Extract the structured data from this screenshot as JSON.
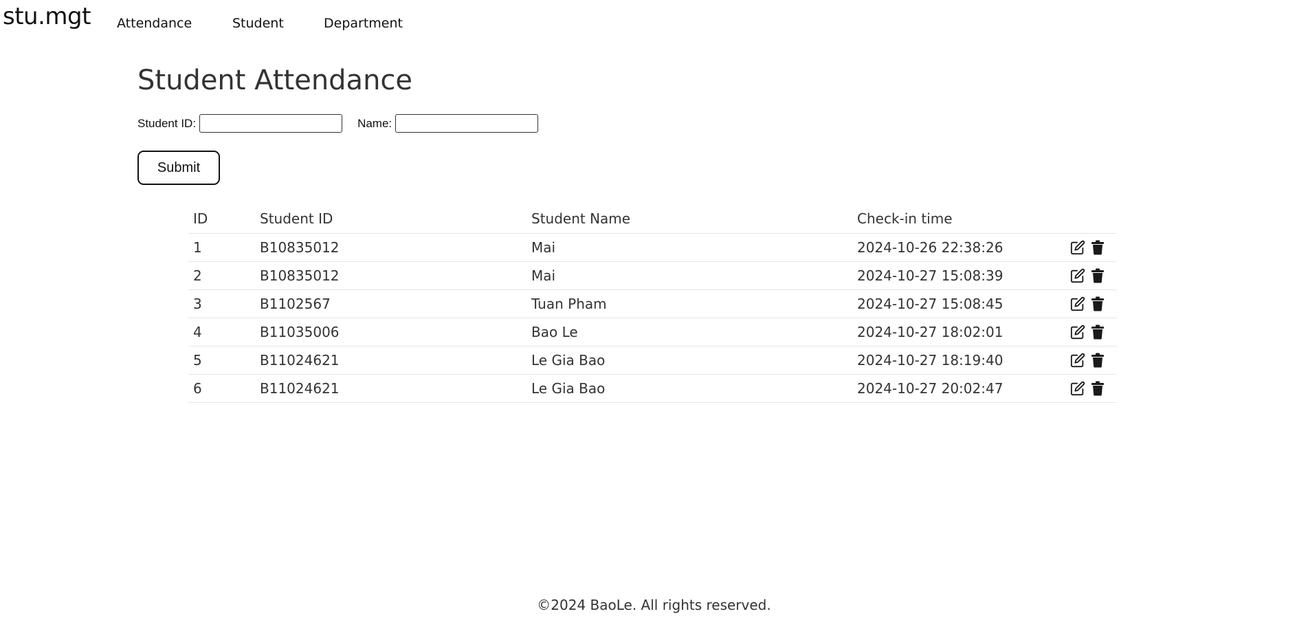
{
  "nav": {
    "brand": "stu.mgt",
    "links": [
      "Attendance",
      "Student",
      "Department"
    ]
  },
  "main": {
    "title": "Student Attendance",
    "form": {
      "student_id_label": "Student ID:",
      "student_id_value": "",
      "name_label": "Name:",
      "name_value": "",
      "submit_label": "Submit"
    },
    "table": {
      "headers": [
        "ID",
        "Student ID",
        "Student Name",
        "Check-in time",
        ""
      ],
      "rows": [
        {
          "id": "1",
          "student_id": "B10835012",
          "name": "Mai",
          "time": "2024-10-26 22:38:26"
        },
        {
          "id": "2",
          "student_id": "B10835012",
          "name": "Mai",
          "time": "2024-10-27 15:08:39"
        },
        {
          "id": "3",
          "student_id": "B1102567",
          "name": "Tuan Pham",
          "time": "2024-10-27 15:08:45"
        },
        {
          "id": "4",
          "student_id": "B11035006",
          "name": "Bao Le",
          "time": "2024-10-27 18:02:01"
        },
        {
          "id": "5",
          "student_id": "B11024621",
          "name": "Le Gia Bao",
          "time": "2024-10-27 18:19:40"
        },
        {
          "id": "6",
          "student_id": "B11024621",
          "name": "Le Gia Bao",
          "time": "2024-10-27 20:02:47"
        }
      ],
      "row_action_icons": [
        "edit-icon",
        "trash-icon"
      ]
    }
  },
  "footer": {
    "text": "©2024 BaoLe. All rights reserved."
  }
}
